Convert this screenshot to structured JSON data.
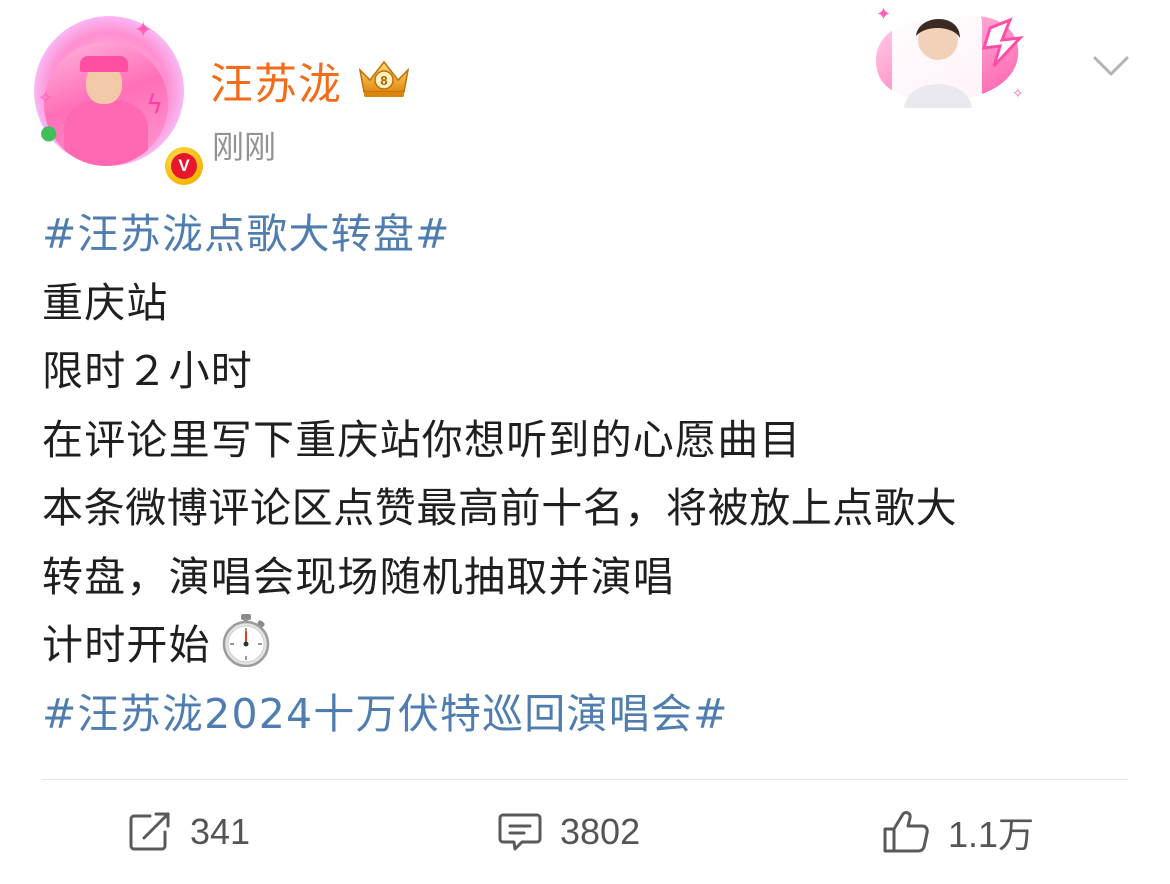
{
  "header": {
    "username": "汪苏泷",
    "timestamp": "刚刚",
    "verified_badge_letter": "V",
    "crown_badge_number": "8",
    "name_color": "#f46b19"
  },
  "post": {
    "lines": [
      {
        "text": "#汪苏泷点歌大转盘#",
        "type": "topic"
      },
      {
        "text": "重庆站",
        "type": "text"
      },
      {
        "text": "限时２小时",
        "type": "text"
      },
      {
        "text": "在评论里写下重庆站你想听到的心愿曲目",
        "type": "text"
      },
      {
        "text": "本条微博评论区点赞最高前十名，将被放上点歌大",
        "type": "text"
      },
      {
        "text": "转盘，演唱会现场随机抽取并演唱",
        "type": "text"
      },
      {
        "text": "计时开始",
        "type": "text",
        "icon": "stopwatch-icon"
      },
      {
        "text": "#汪苏泷2024十万伏特巡回演唱会#",
        "type": "topic"
      }
    ],
    "topic_color": "#507daf"
  },
  "actions": {
    "repost_count": "341",
    "comment_count": "3802",
    "like_count": "1.1万",
    "icons": [
      "repost-icon",
      "comment-icon",
      "like-icon"
    ]
  }
}
